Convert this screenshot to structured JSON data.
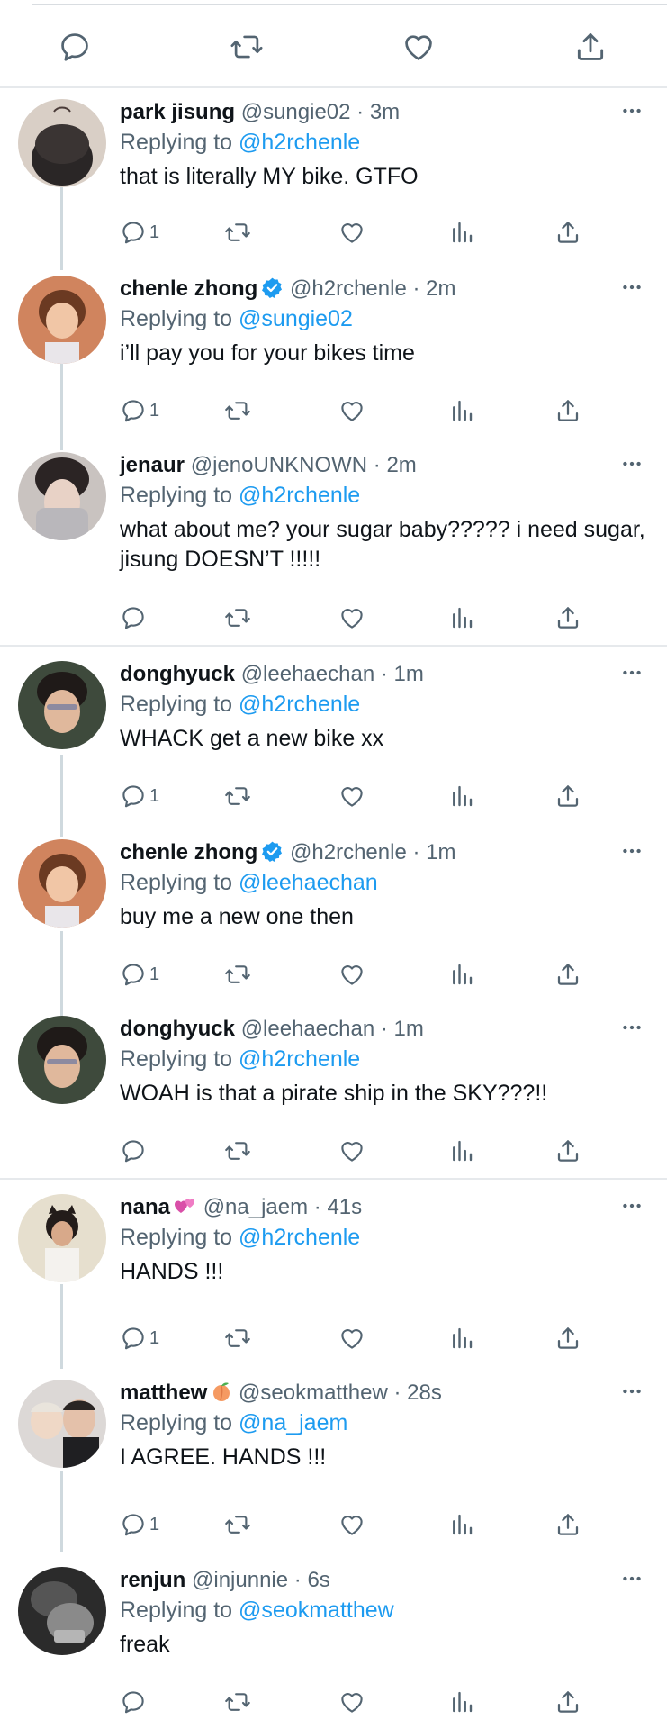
{
  "colors": {
    "link": "#1d9bf0",
    "meta": "#536471",
    "text": "#0f1419",
    "verified": "#1d9bf0",
    "line": "#cfd9de"
  },
  "icons": [
    "reply-icon",
    "retweet-icon",
    "like-icon",
    "share-icon",
    "analytics-icon",
    "more-icon",
    "verified-badge-icon",
    "hearts-emoji-icon",
    "peach-emoji-icon"
  ],
  "tweets": [
    {
      "name": "park jisung",
      "handle": "@sungie02",
      "time": "· 3m",
      "replying_prefix": "Replying to",
      "mention": "@h2rchenle",
      "text": "that is literally MY bike. GTFO",
      "reply_count": "1"
    },
    {
      "name": "chenle zhong",
      "handle": "@h2rchenle",
      "time": "· 2m",
      "replying_prefix": "Replying to",
      "mention": "@sungie02",
      "text": "i’ll pay you for your bikes time",
      "reply_count": "1"
    },
    {
      "name": "jenaur",
      "handle": "@jenoUNKNOWN",
      "time": "· 2m",
      "replying_prefix": "Replying to",
      "mention": "@h2rchenle",
      "text": "what about me? your sugar baby????? i need sugar, jisung DOESN’T !!!!!",
      "reply_count": ""
    },
    {
      "name": "donghyuck",
      "handle": "@leehaechan",
      "time": "· 1m",
      "replying_prefix": "Replying to",
      "mention": "@h2rchenle",
      "text": "WHACK get a new bike xx",
      "reply_count": "1"
    },
    {
      "name": "chenle zhong",
      "handle": "@h2rchenle",
      "time": "· 1m",
      "replying_prefix": "Replying to",
      "mention": "@leehaechan",
      "text": "buy me a new one then",
      "reply_count": "1"
    },
    {
      "name": "donghyuck",
      "handle": "@leehaechan",
      "time": "· 1m",
      "replying_prefix": "Replying to",
      "mention": "@h2rchenle",
      "text": "WOAH is that a pirate ship in the SKY???!!",
      "reply_count": ""
    },
    {
      "name": "nana",
      "handle": "@na_jaem",
      "time": "· 41s",
      "replying_prefix": "Replying to",
      "mention": "@h2rchenle",
      "text": "HANDS !!!",
      "reply_count": "1"
    },
    {
      "name": "matthew",
      "handle": "@seokmatthew",
      "time": "· 28s",
      "replying_prefix": "Replying to",
      "mention": "@na_jaem",
      "text": "I AGREE. HANDS !!!",
      "reply_count": "1"
    },
    {
      "name": "renjun",
      "handle": "@injunnie",
      "time": "· 6s",
      "replying_prefix": "Replying to",
      "mention": "@seokmatthew",
      "text": "freak",
      "reply_count": ""
    }
  ]
}
